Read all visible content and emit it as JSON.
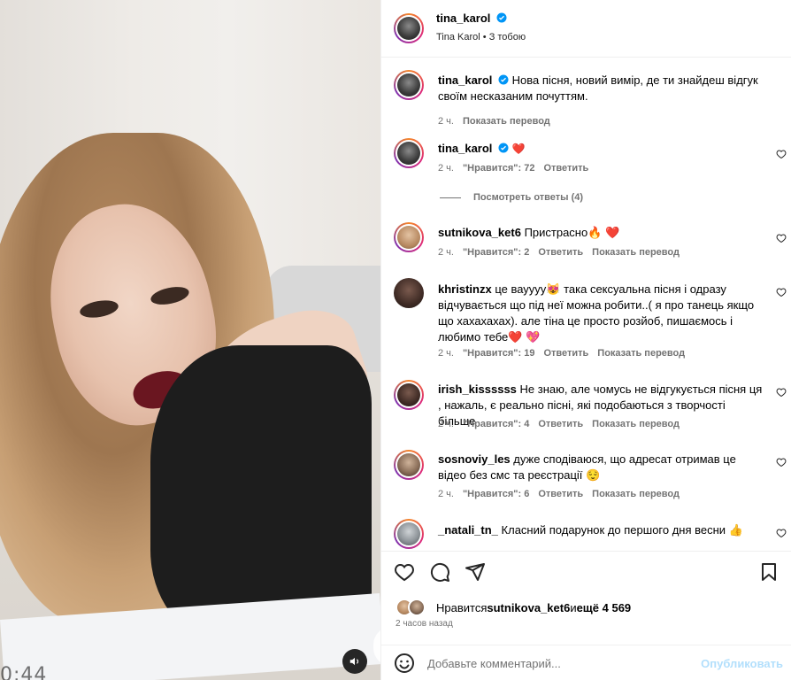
{
  "media": {
    "timecode": "0:44",
    "sound_icon": "volume-icon"
  },
  "header": {
    "username": "tina_karol",
    "subtitle": "Tina Karol • З тобою"
  },
  "caption": {
    "username": "tina_karol",
    "text": "Нова пісня, новий вимір, де ти знайдеш відгук своїм несказаним почуттям.",
    "time": "2 ч.",
    "translate": "Показать перевод"
  },
  "comments": [
    {
      "username": "tina_karol",
      "text": "❤️",
      "time": "2 ч.",
      "likes": "\"Нравится\": 72",
      "reply": "Ответить",
      "translate": ""
    },
    {
      "username": "sutnikova_ket6",
      "text": "Пристрасно🔥 ❤️",
      "time": "2 ч.",
      "likes": "\"Нравится\": 2",
      "reply": "Ответить",
      "translate": "Показать перевод"
    },
    {
      "username": "khristinzx",
      "text": "це вауууу😻 така сексуальна пісня і одразу відчувається що під неї можна робити..( я про танець якщо що хахахахах). але тіна це просто розйоб, пишаємось і любимо тебе❤️ 💖",
      "time": "2 ч.",
      "likes": "\"Нравится\": 19",
      "reply": "Ответить",
      "translate": "Показать перевод"
    },
    {
      "username": "irish_kissssss",
      "text": "Не знаю, але чомусь не відгукується пісня ця , нажаль, є реально пісні, які подобаються з творчості більше",
      "time": "2 ч.",
      "likes": "\"Нравится\": 4",
      "reply": "Ответить",
      "translate": "Показать перевод"
    },
    {
      "username": "sosnoviy_les",
      "text": "дуже сподіваюся, що адресат отримав це відео без смс та реєстрації 😌",
      "time": "2 ч.",
      "likes": "\"Нравится\": 6",
      "reply": "Ответить",
      "translate": "Показать перевод"
    },
    {
      "username": "_natali_tn_",
      "text": "Класний подарунок до першого дня весни 👍",
      "time": "",
      "likes": "",
      "reply": "",
      "translate": ""
    }
  ],
  "replies": {
    "label": "Посмотреть ответы (4)"
  },
  "likes_line": {
    "prefix": "Нравится ",
    "user": "sutnikova_ket6",
    "middle": " и ",
    "rest": "ещё 4 569"
  },
  "post_time": "2 часов назад",
  "add_comment": {
    "placeholder": "Добавьте комментарий...",
    "publish": "Опубликовать"
  },
  "colors": {
    "accent": "#0095f6",
    "publish_disabled": "#b2dffc",
    "heart_red": "#ff3040",
    "muted": "#737373"
  }
}
